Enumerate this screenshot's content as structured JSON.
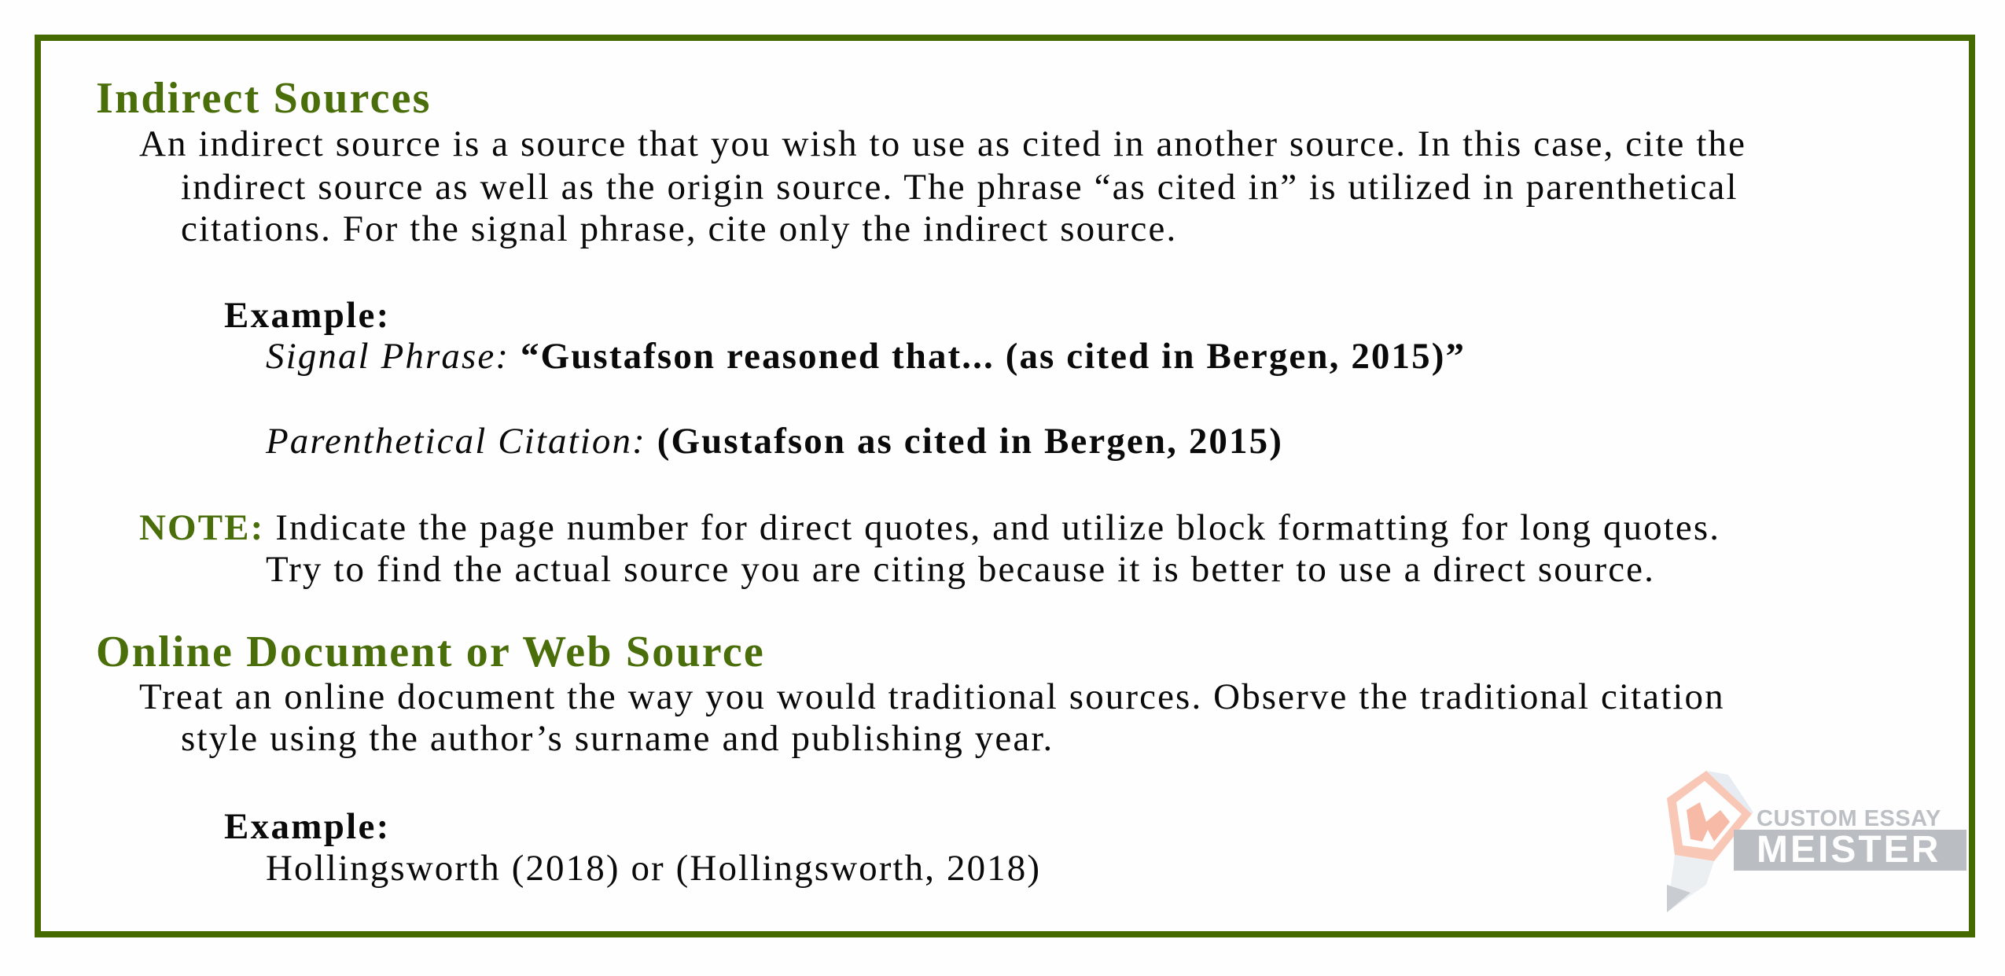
{
  "sections": [
    {
      "heading": "Indirect Sources",
      "body_lines": [
        "An indirect source is a source that you wish to use as cited in another source. In this case, cite the",
        "indirect source as well as the origin source. The phrase “as cited in” is utilized in parenthetical",
        "citations. For the signal phrase, cite only the indirect source."
      ],
      "example": {
        "label": "Example:",
        "signal_phrase_label": "Signal Phrase:",
        "signal_phrase_value": "“Gustafson reasoned that... (as cited in Bergen, 2015)”",
        "parenthetical_label": "Parenthetical Citation:",
        "parenthetical_value": "(Gustafson as cited in Bergen, 2015)"
      },
      "note": {
        "label": "NOTE:",
        "lines": [
          "Indicate the page number for direct quotes, and utilize block formatting for long quotes.",
          "Try to find the actual source you are citing because it is better to use a direct source."
        ]
      }
    },
    {
      "heading": "Online Document or Web Source",
      "body_lines": [
        "Treat an online document the way you would traditional sources. Observe the traditional citation",
        "style using the author’s surname and publishing year."
      ],
      "example": {
        "label": "Example:",
        "value": "Hollingsworth (2018) or (Hollingsworth, 2018)"
      }
    }
  ],
  "logo": {
    "icon": "pencil-m-icon",
    "top_text": "CUSTOM ESSAY",
    "main_text": "MEISTER",
    "icon_letter": "M"
  },
  "colors": {
    "accent_green": "#4a6e0a",
    "frame_green": "#456a00",
    "logo_gray": "#a4a9ae",
    "logo_orange": "#f4a48a"
  }
}
